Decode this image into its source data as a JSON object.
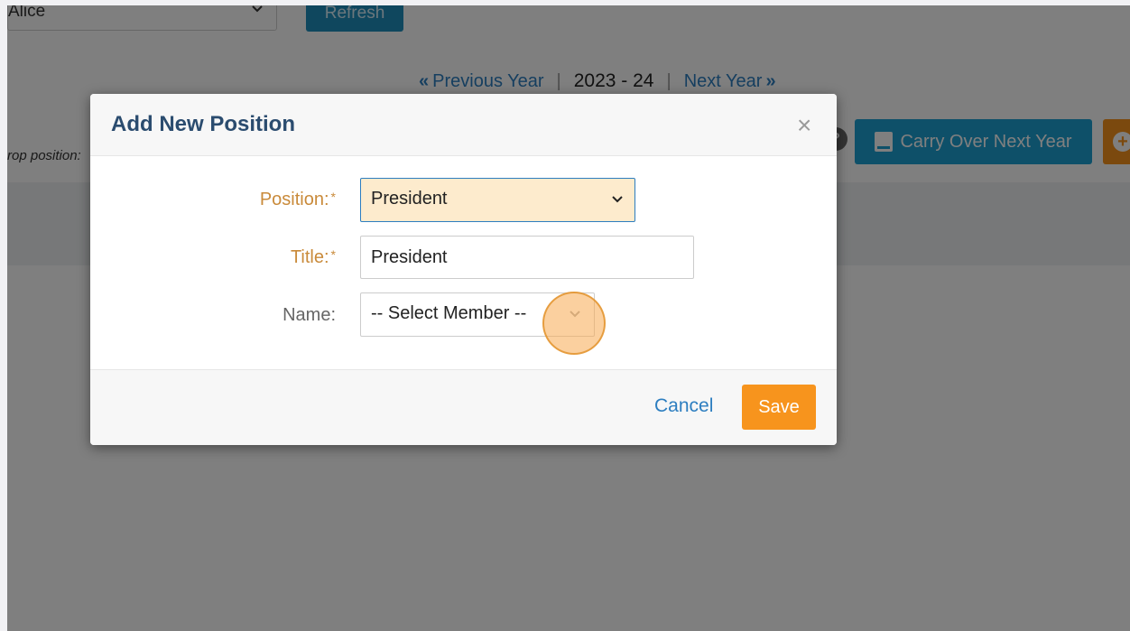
{
  "background": {
    "member_select_value": "Alice",
    "refresh_label": "Refresh",
    "year_nav": {
      "prev_label": "Previous Year",
      "separator": "|",
      "current": "2023 - 24",
      "next_label": "Next Year"
    },
    "carry_over_label": "Carry Over Next Year",
    "drop_hint": "rop position:"
  },
  "modal": {
    "title": "Add New Position",
    "close_glyph": "×",
    "fields": {
      "position": {
        "label": "Position:",
        "required_mark": "*",
        "value": "President"
      },
      "title": {
        "label": "Title:",
        "required_mark": "*",
        "value": "President"
      },
      "name": {
        "label": "Name:",
        "value": "-- Select Member --"
      }
    },
    "cancel_label": "Cancel",
    "save_label": "Save"
  },
  "colors": {
    "accent_blue": "#2d7ec0",
    "save_orange": "#f7941d",
    "carry_blue": "#1da1d3",
    "required_label": "#c98a3a"
  }
}
